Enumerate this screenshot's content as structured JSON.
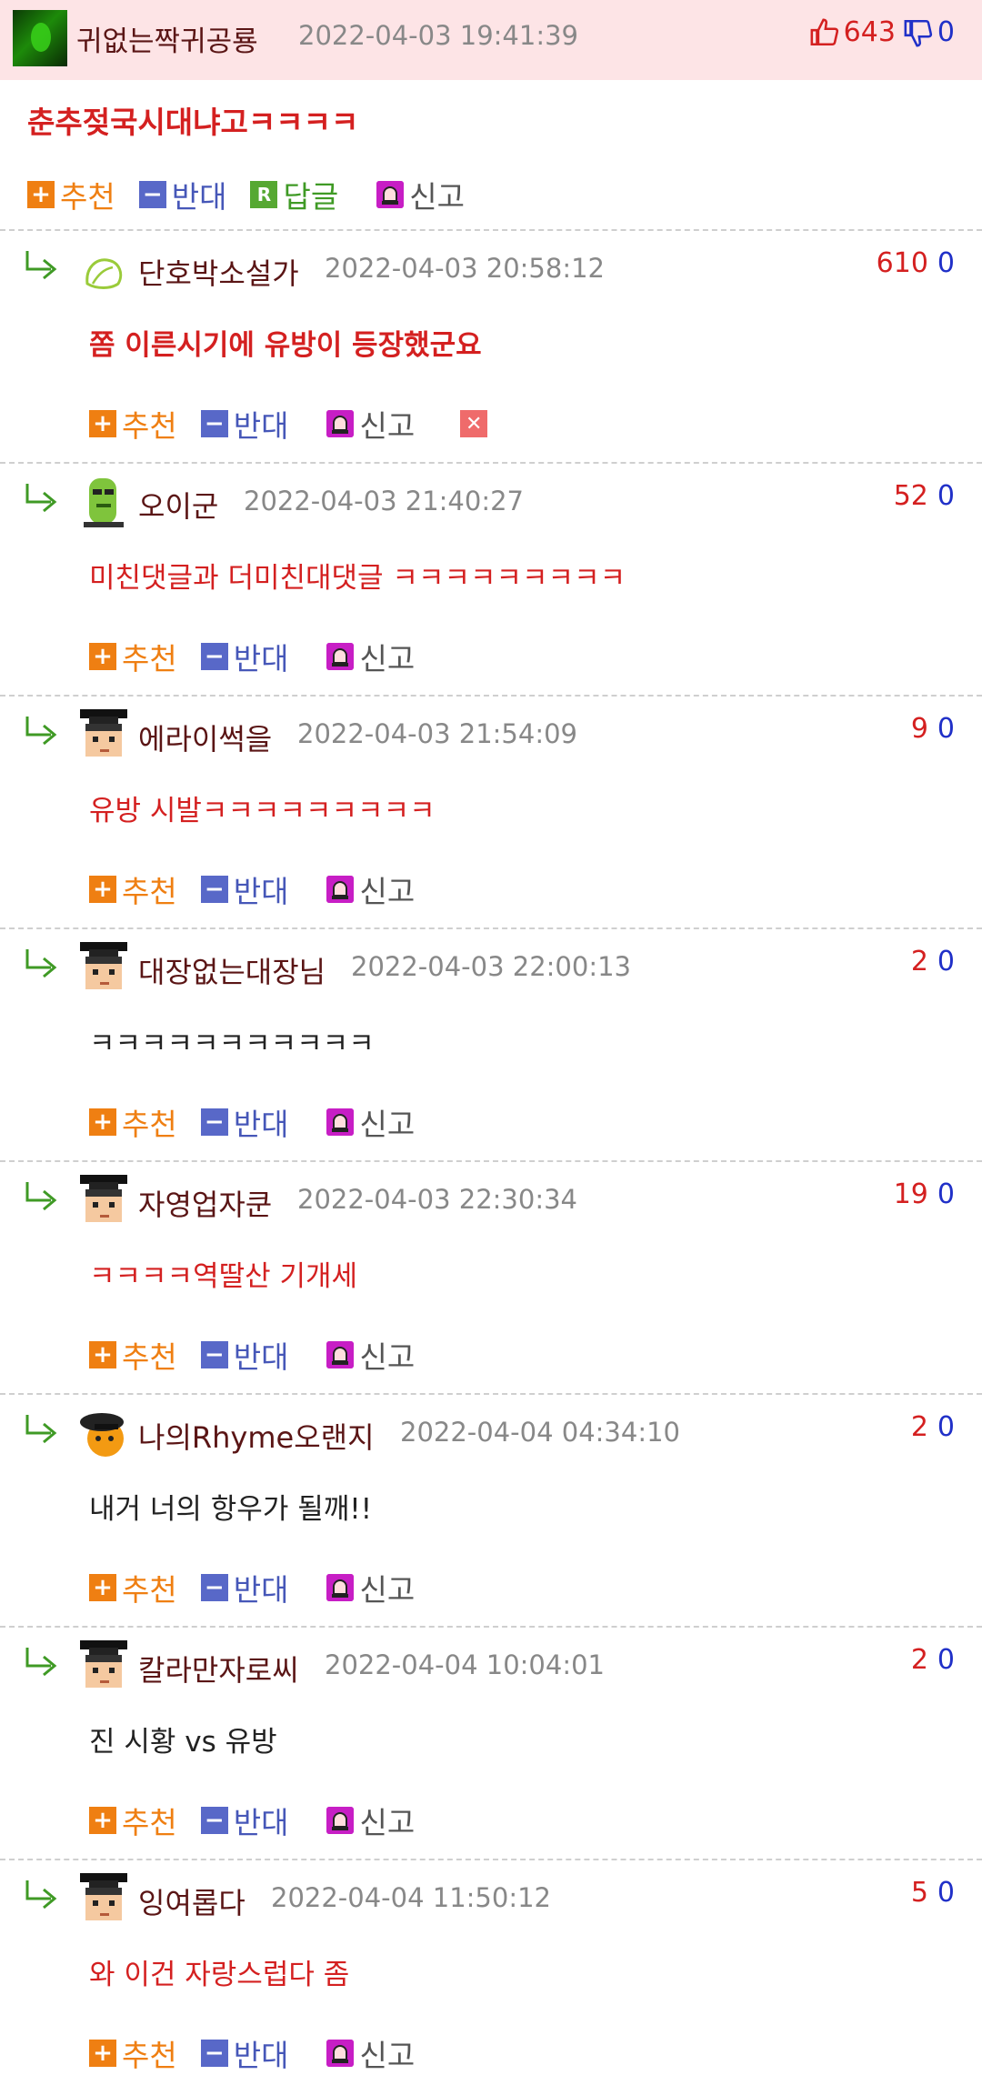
{
  "post": {
    "author": "귀없는짝귀공룡",
    "time": "2022-04-03 19:41:39",
    "upvotes": "643",
    "downvotes": "0",
    "text": "춘추젖국시대냐고ㅋㅋㅋㅋ",
    "actions": {
      "recommend": "추천",
      "oppose": "반대",
      "reply": "답글",
      "report": "신고"
    }
  },
  "comments": [
    {
      "author": "단호박소설가",
      "time": "2022-04-03 20:58:12",
      "up": "610",
      "down": "0",
      "text": "쫌 이른시기에 유방이 등장했군요",
      "bold": true,
      "color": "red",
      "avatar": "leaf",
      "delete": true
    },
    {
      "author": "오이군",
      "time": "2022-04-03 21:40:27",
      "up": "52",
      "down": "0",
      "text": "미친댓글과 더미친대댓글 ㅋㅋㅋㅋㅋㅋㅋㅋㅋ",
      "color": "red",
      "avatar": "cucumber"
    },
    {
      "author": "에라이썩을",
      "time": "2022-04-03 21:54:09",
      "up": "9",
      "down": "0",
      "text": "유방 시발ㅋㅋㅋㅋㅋㅋㅋㅋㅋ",
      "color": "red",
      "avatar": "grad"
    },
    {
      "author": "대장없는대장님",
      "time": "2022-04-03 22:00:13",
      "up": "2",
      "down": "0",
      "text": "ㅋㅋㅋㅋㅋㅋㅋㅋㅋㅋㅋ",
      "color": "black",
      "avatar": "grad"
    },
    {
      "author": "자영업자쿤",
      "time": "2022-04-03 22:30:34",
      "up": "19",
      "down": "0",
      "text": "ㅋㅋㅋㅋ역딸산 기개세",
      "color": "red",
      "avatar": "grad"
    },
    {
      "author": "나의Rhyme오랜지",
      "time": "2022-04-04 04:34:10",
      "up": "2",
      "down": "0",
      "text": "내거 너의 항우가 될깨!!",
      "color": "black",
      "avatar": "orange"
    },
    {
      "author": "칼라만자로씨",
      "time": "2022-04-04 10:04:01",
      "up": "2",
      "down": "0",
      "text": "진 시황 vs 유방",
      "color": "black",
      "avatar": "grad"
    },
    {
      "author": "잉여롭다",
      "time": "2022-04-04 11:50:12",
      "up": "5",
      "down": "0",
      "text": "와 이건 자랑스럽다 좀",
      "color": "red",
      "avatar": "grad"
    }
  ],
  "colors": {
    "header_bg": "#fde4e6",
    "accent_red": "#d42020",
    "accent_blue": "#2030c8",
    "orange": "#ef7f12"
  }
}
